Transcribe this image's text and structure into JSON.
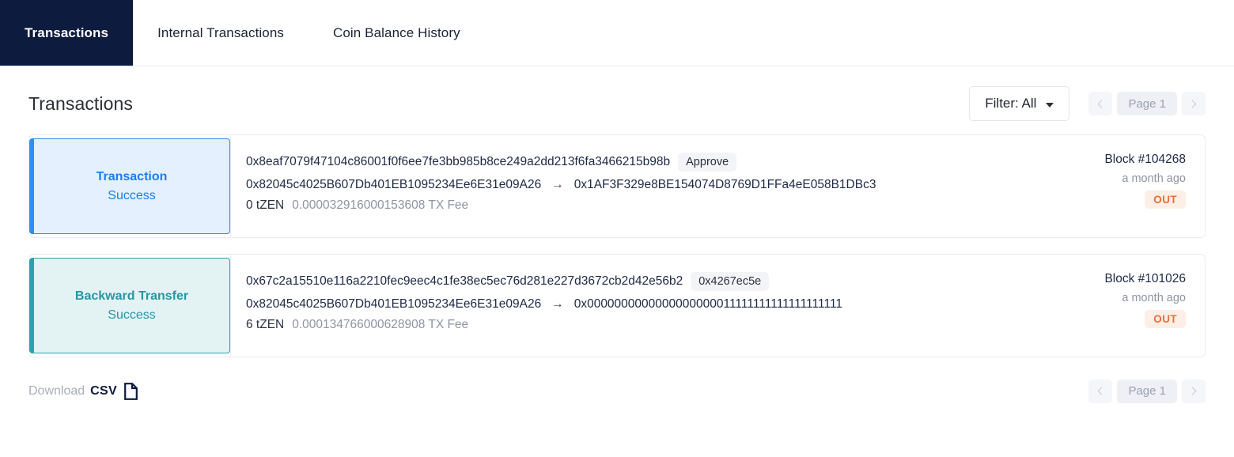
{
  "tabs": [
    {
      "label": "Transactions",
      "active": true
    },
    {
      "label": "Internal Transactions",
      "active": false
    },
    {
      "label": "Coin Balance History",
      "active": false
    }
  ],
  "header": {
    "title": "Transactions",
    "filter_label": "Filter: All",
    "prev_icon": "chevron-left-icon",
    "next_icon": "chevron-right-icon",
    "page_label": "Page 1"
  },
  "transactions": [
    {
      "type": "Transaction",
      "status": "Success",
      "accent": "#2f8ef4",
      "hash": "0x8eaf7079f47104c86001f0f6ee7fe3bb985b8ce249a2dd213f6fa3466215b98b",
      "method_badge": "Approve",
      "from": "0x82045c4025B607Db401EB1095234Ee6E31e09A26",
      "arrow": "→",
      "to": "0x1AF3F329e8BE154074D8769D1FFa4eE058B1DBc3",
      "amount": "0 tZEN",
      "fee": "0.000032916000153608 TX Fee",
      "block": "Block #104268",
      "age": "a month ago",
      "direction": "OUT"
    },
    {
      "type": "Backward Transfer",
      "status": "Success",
      "accent": "#2aa3ae",
      "hash": "0x67c2a15510e116a2210fec9eec4c1fe38ec5ec76d281e227d3672cb2d42e56b2",
      "method_badge": "0x4267ec5e",
      "from": "0x82045c4025B607Db401EB1095234Ee6E31e09A26",
      "arrow": "→",
      "to": "0x0000000000000000000011111111111111111111",
      "amount": "6 tZEN",
      "fee": "0.000134766000628908 TX Fee",
      "block": "Block #101026",
      "age": "a month ago",
      "direction": "OUT"
    }
  ],
  "footer": {
    "download_word": "Download",
    "csv_word": "CSV",
    "csv_icon": "document-icon",
    "prev_icon": "chevron-left-icon",
    "next_icon": "chevron-right-icon",
    "page_label": "Page 1"
  }
}
